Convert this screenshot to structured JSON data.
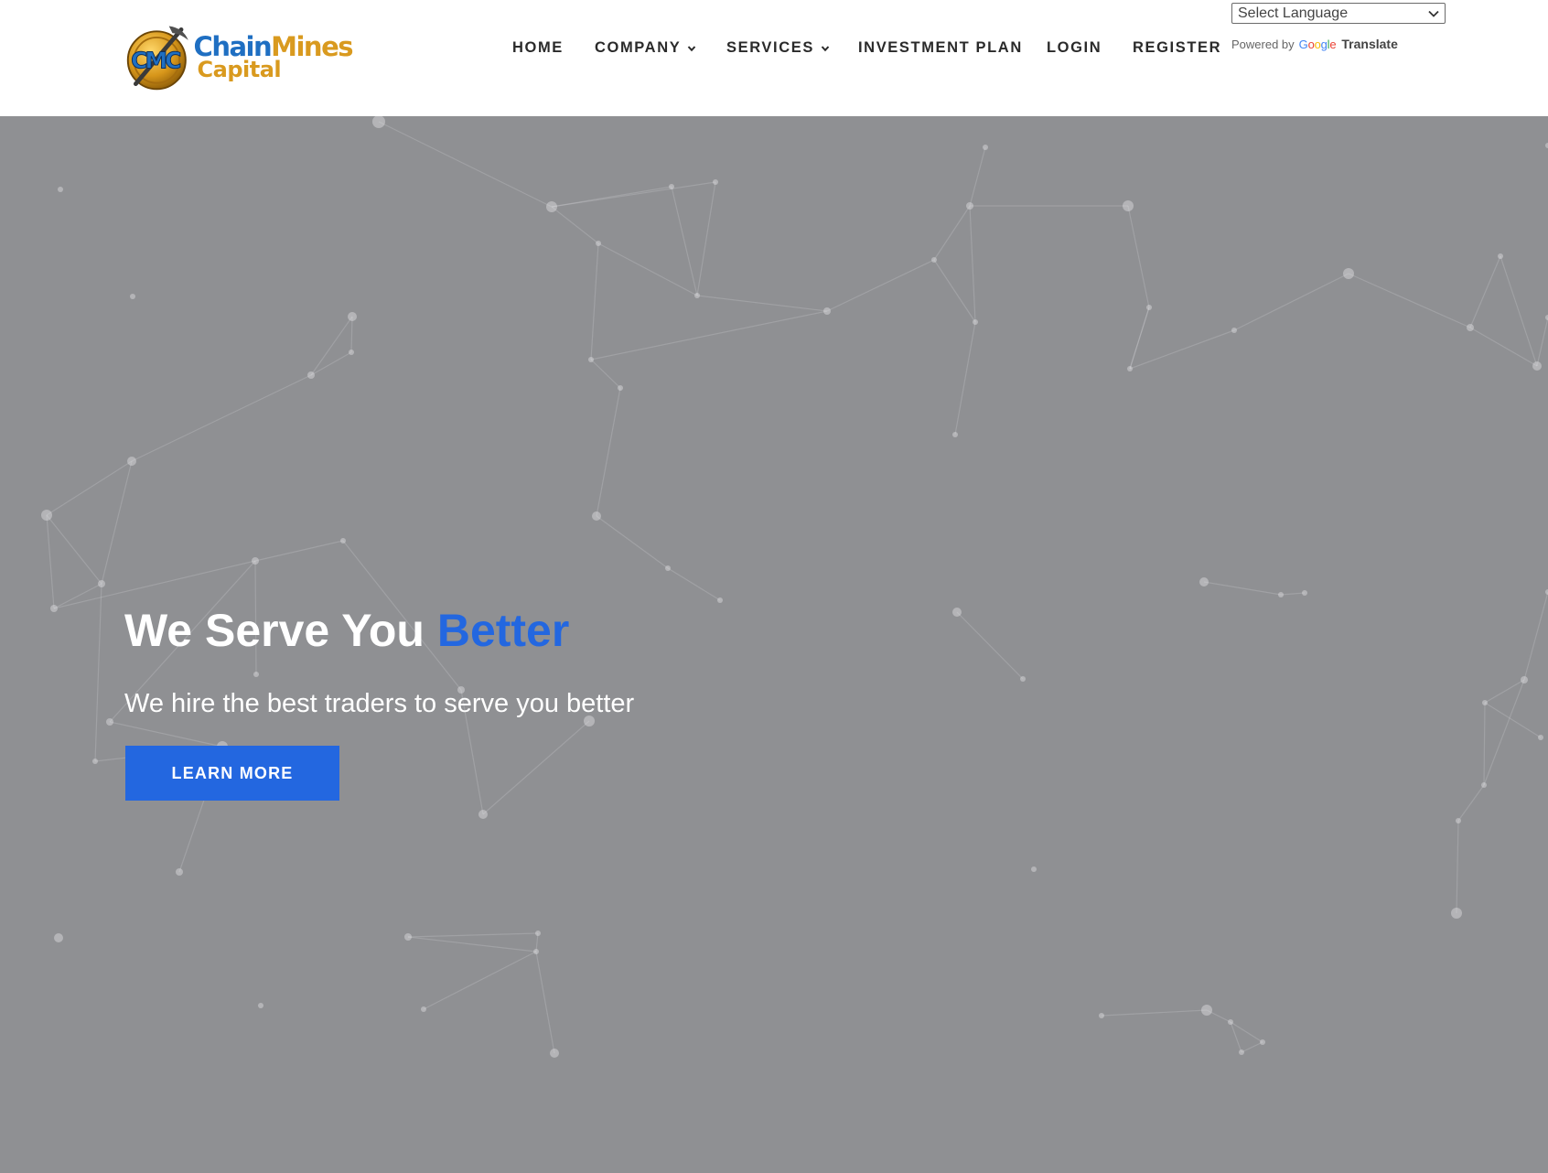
{
  "brand": {
    "logo_badge": "CMC",
    "name_part1": "Chain",
    "name_part2": "Mines",
    "name_line2": "Capital",
    "colors": {
      "blue": "#1f6fc2",
      "gold": "#d99a1f"
    }
  },
  "nav": {
    "items": [
      {
        "label": "HOME",
        "has_dropdown": false
      },
      {
        "label": "COMPANY",
        "has_dropdown": true
      },
      {
        "label": "SERVICES",
        "has_dropdown": true
      },
      {
        "label": "INVESTMENT PLAN",
        "has_dropdown": false
      },
      {
        "label": "LOGIN",
        "has_dropdown": false
      },
      {
        "label": "REGISTER",
        "has_dropdown": false
      }
    ],
    "dropdown_icon": "chevron-down-icon"
  },
  "translate": {
    "select_value": "Select Language",
    "powered_by": "Powered by",
    "google_letters": [
      "G",
      "o",
      "o",
      "g",
      "l",
      "e"
    ],
    "translate_label": "Translate"
  },
  "hero": {
    "title_main": "We Serve You",
    "title_accent": "Better",
    "subtitle": "We hire the best traders to serve you better",
    "cta_label": "LEARN MORE",
    "background_color": "#8f9093",
    "accent_color": "#2367e0"
  }
}
